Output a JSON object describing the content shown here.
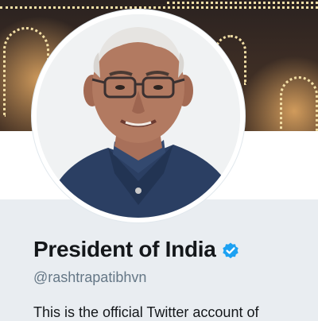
{
  "profile": {
    "display_name": "President of India",
    "handle": "@rashtrapatibhvn",
    "bio": "This is the official Twitter account of"
  },
  "icons": {
    "verified": "verified-badge-icon",
    "avatar": "profile-photo"
  },
  "colors": {
    "verified_badge": "#1da1f2",
    "name_text": "#14171a",
    "handle_text": "#657786",
    "page_background": "#e9edf1"
  }
}
